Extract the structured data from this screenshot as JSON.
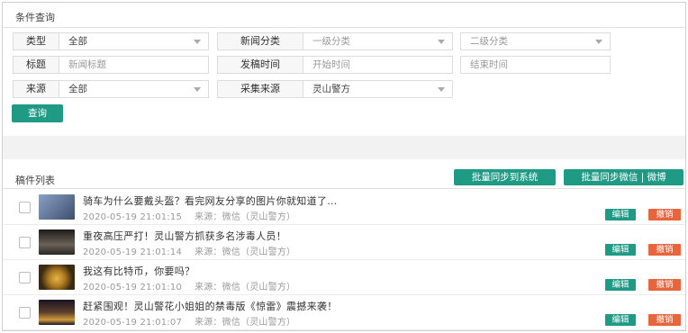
{
  "query": {
    "title": "条件查询",
    "type_label": "类型",
    "type_value": "全部",
    "news_cat_label": "新闻分类",
    "level1_placeholder": "一级分类",
    "level2_placeholder": "二级分类",
    "headline_label": "标题",
    "headline_placeholder": "新闻标题",
    "date_label": "发稿时间",
    "start_placeholder": "开始时间",
    "end_placeholder": "结束时间",
    "source_label": "来源",
    "source_value": "全部",
    "collect_label": "采集来源",
    "collect_value": "灵山警方",
    "search_button": "查询"
  },
  "list": {
    "title": "稿件列表",
    "sync_system_button": "批量同步到系统",
    "sync_wechat_button": "批量同步微信 | 微博",
    "edit_label": "编辑",
    "revoke_label": "撤销",
    "source_prefix": "来源：",
    "items": [
      {
        "title": "骑车为什么要戴头盔？看完网友分享的图片你就知道了...",
        "time": "2020-05-19 21:01:15",
        "source": "微信（灵山警方）",
        "thumb_color": "#5a6e8c"
      },
      {
        "title": "重夜高压严打！灵山警方抓获多名涉毒人员！",
        "time": "2020-05-19 21:01:14",
        "source": "微信（灵山警方）",
        "thumb_color": "#3d3a36"
      },
      {
        "title": "我这有比特币，你要吗？",
        "time": "2020-05-19 21:01:10",
        "source": "微信（灵山警方）",
        "thumb_color": "#8a6a2e"
      },
      {
        "title": "赶紧围观！灵山警花小姐姐的禁毒版《惊雷》震撼来袭！",
        "time": "2020-05-19 21:01:07",
        "source": "微信（灵山警方）",
        "thumb_color": "#2b2436"
      }
    ]
  }
}
